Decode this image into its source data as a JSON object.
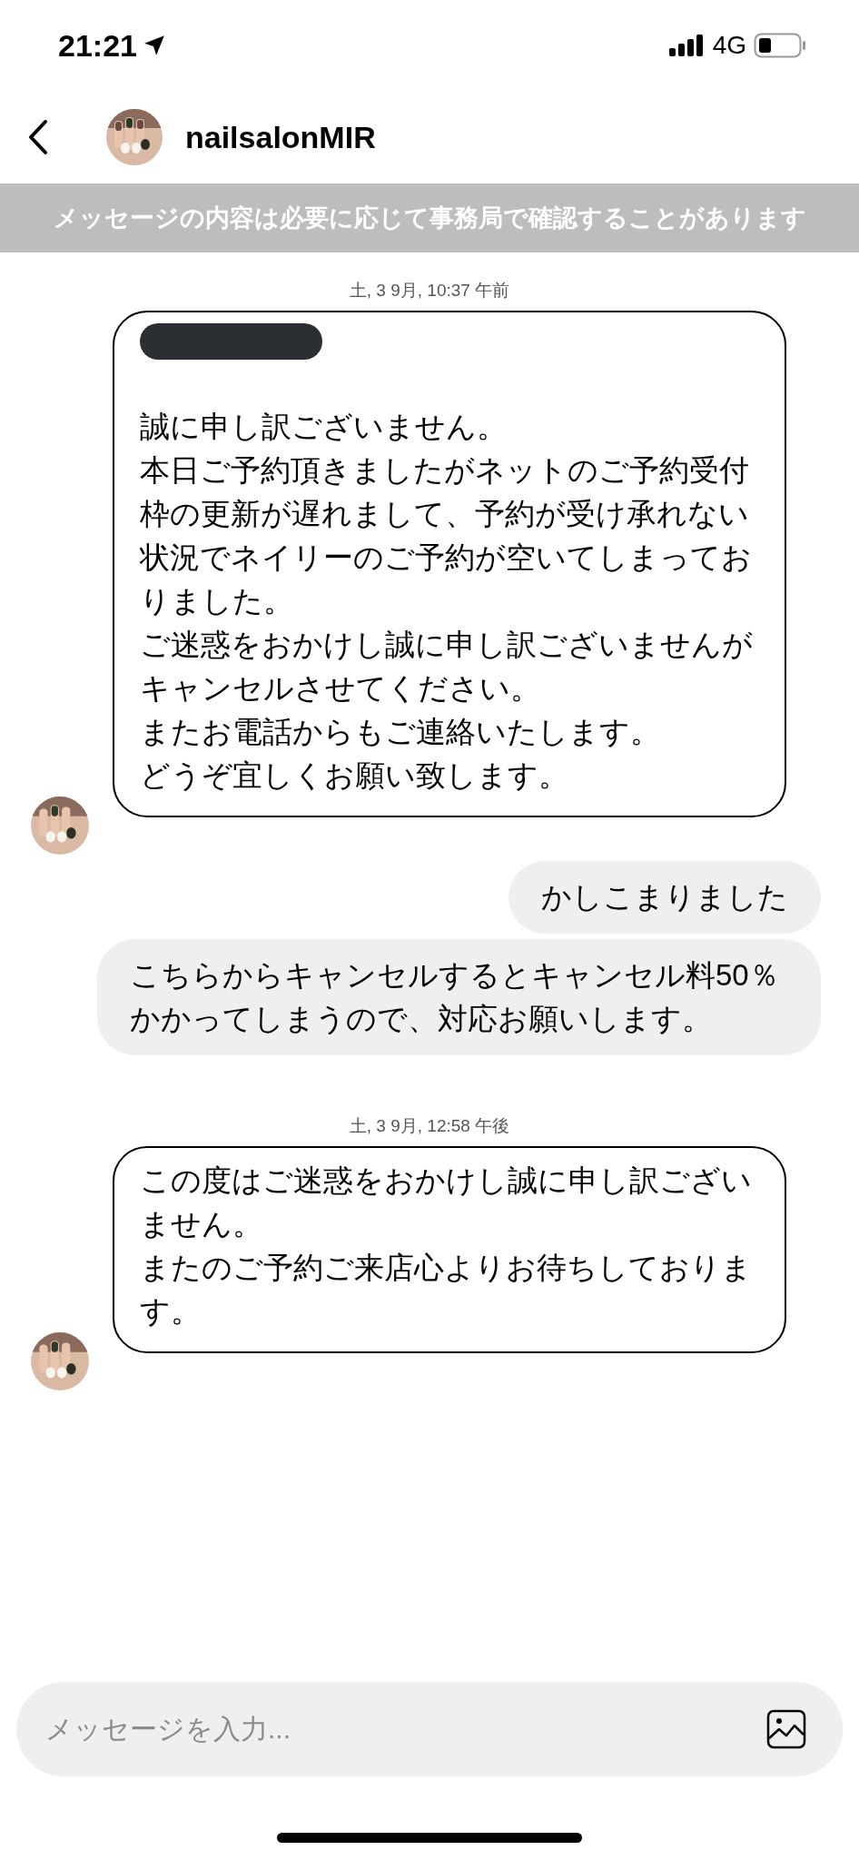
{
  "status_bar": {
    "time": "21:21",
    "network": "4G"
  },
  "header": {
    "name": "nailsalonMIR"
  },
  "notice": "メッセージの内容は必要に応じて事務局で確認することがあります",
  "messages": [
    {
      "kind": "timestamp",
      "text": "土, 3 9月, 10:37 午前"
    },
    {
      "kind": "received",
      "redacted": true,
      "paragraphs": [
        "誠に申し訳ございません。",
        "本日ご予約頂きましたがネットのご予約受付枠の更新が遅れまして、予約が受け承れない状況でネイリーのご予約が空いてしまっておりました。",
        "ご迷惑をおかけし誠に申し訳ございませんがキャンセルさせてください。",
        "またお電話からもご連絡いたします。",
        "どうぞ宜しくお願い致します。"
      ]
    },
    {
      "kind": "sent",
      "text": "かしこまりました"
    },
    {
      "kind": "sent",
      "text": "こちらからキャンセルするとキャンセル料50％かかってしまうので、対応お願いします。"
    },
    {
      "kind": "timestamp",
      "text": "土, 3 9月, 12:58 午後"
    },
    {
      "kind": "received",
      "redacted": false,
      "paragraphs": [
        "この度はご迷惑をおかけし誠に申し訳ございません。",
        "またのご予約ご来店心よりお待ちしております。"
      ]
    }
  ],
  "composer": {
    "placeholder": "メッセージを入力..."
  }
}
